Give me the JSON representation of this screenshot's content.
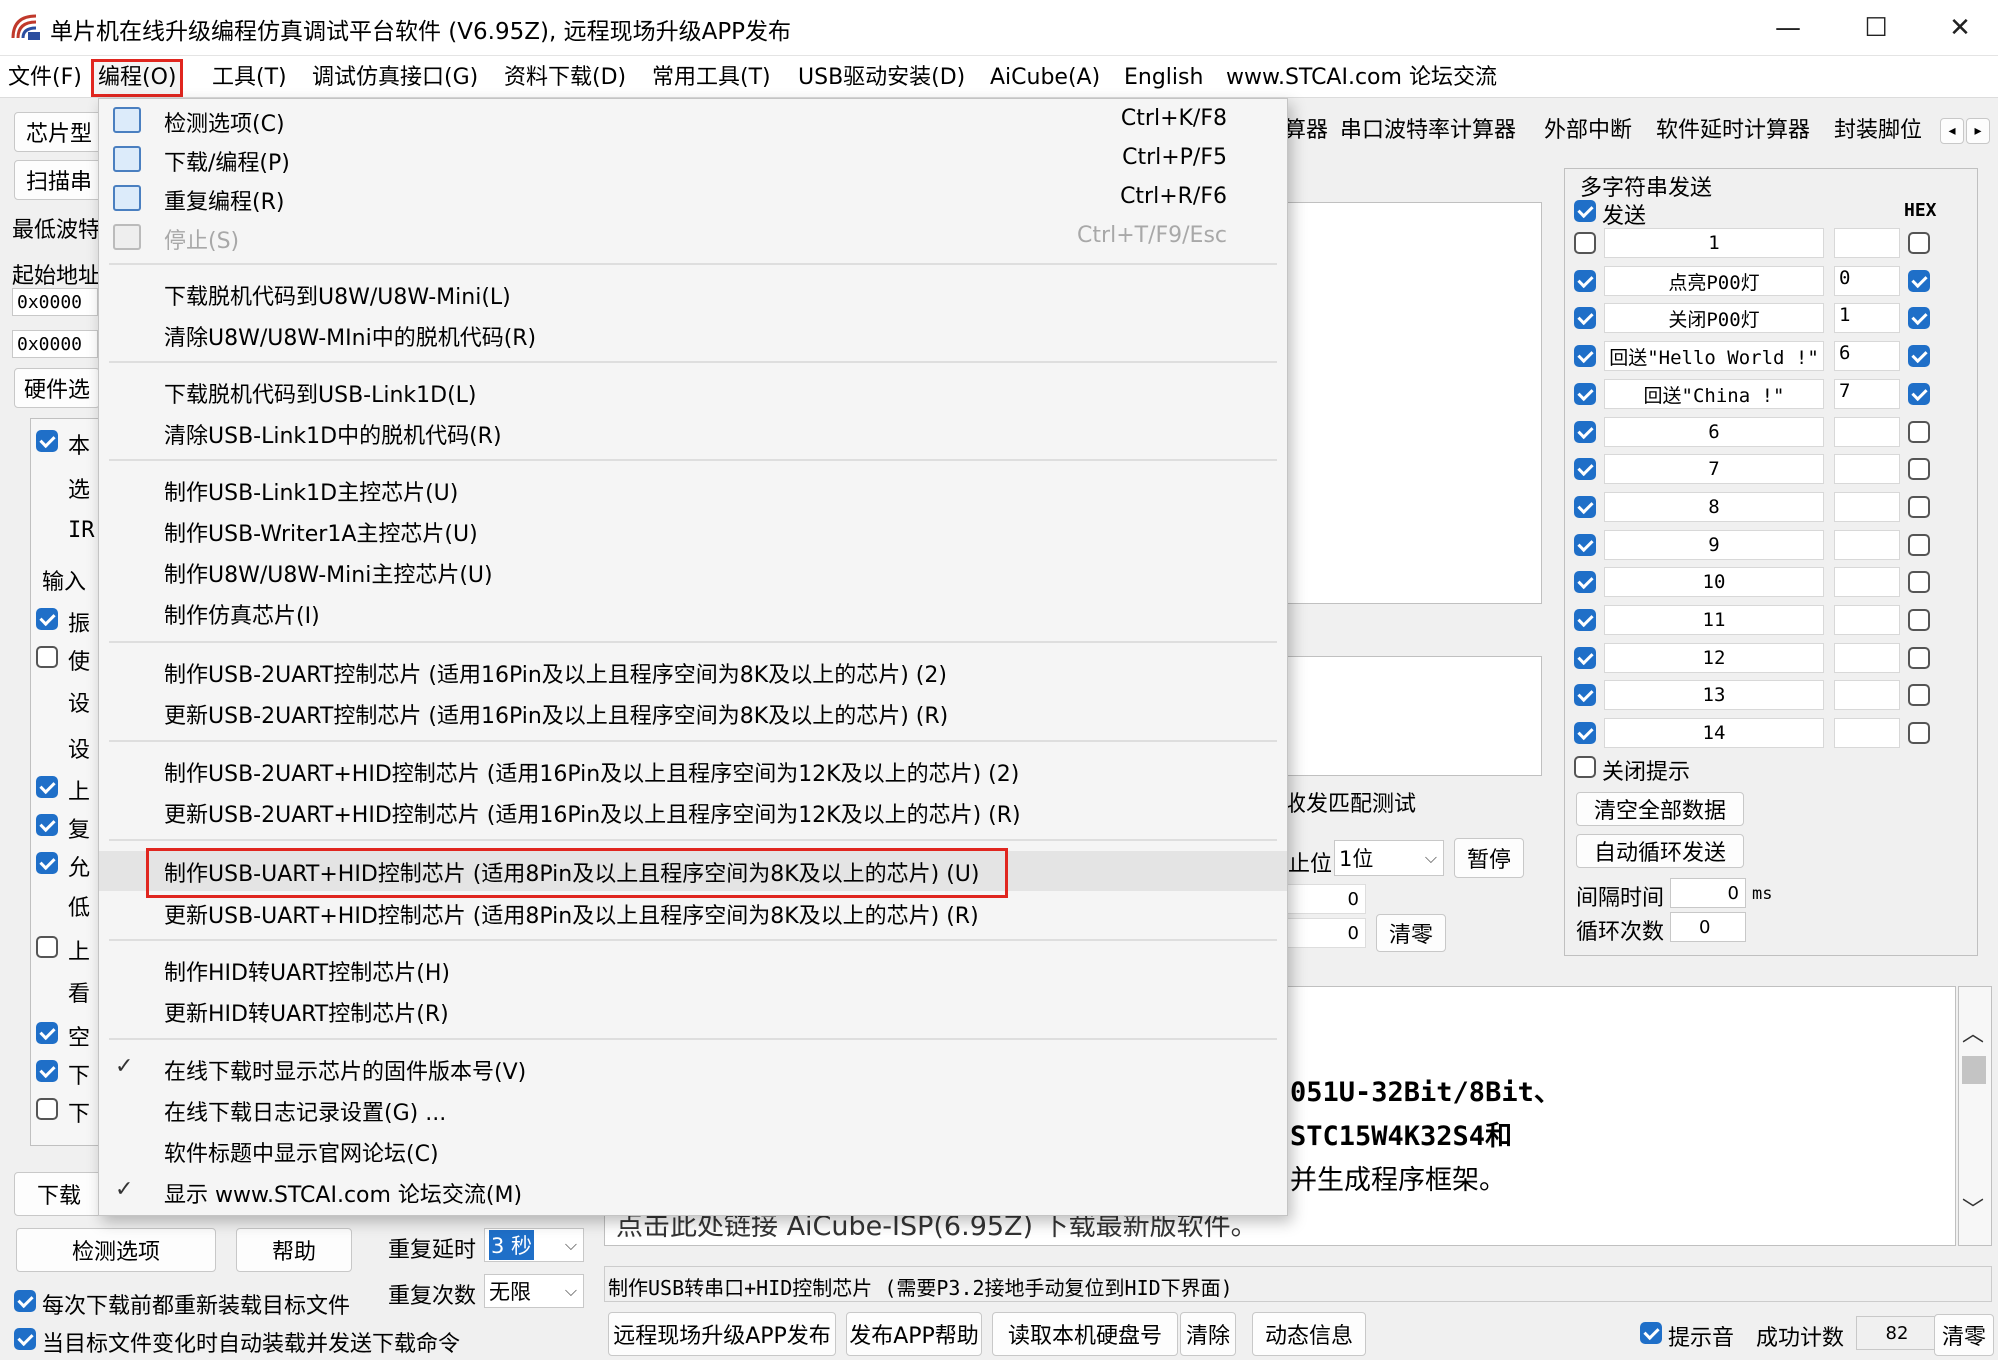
{
  "window": {
    "title": "单片机在线升级编程仿真调试平台软件 (V6.95Z), 远程现场升级APP发布",
    "minimize": "—",
    "maximize": "☐",
    "close": "✕"
  },
  "menubar": [
    "文件(F)",
    "编程(O)",
    "工具(T)",
    "调试仿真接口(G)",
    "资料下载(D)",
    "常用工具(T)",
    "USB驱动安装(D)",
    "AiCube(A)",
    "English",
    "www.STCAI.com 论坛交流"
  ],
  "dropdown": {
    "items": [
      {
        "label": "检测选项(C)",
        "shortcut": "Ctrl+K/F8"
      },
      {
        "label": "下载/编程(P)",
        "shortcut": "Ctrl+P/F5"
      },
      {
        "label": "重复编程(R)",
        "shortcut": "Ctrl+R/F6"
      },
      {
        "label": "停止(S)",
        "shortcut": "Ctrl+T/F9/Esc"
      },
      {
        "label": "下载脱机代码到U8W/U8W-Mini(L)",
        "shortcut": ""
      },
      {
        "label": "清除U8W/U8W-MIni中的脱机代码(R)",
        "shortcut": ""
      },
      {
        "label": "下载脱机代码到USB-Link1D(L)",
        "shortcut": ""
      },
      {
        "label": "清除USB-Link1D中的脱机代码(R)",
        "shortcut": ""
      },
      {
        "label": "制作USB-Link1D主控芯片(U)",
        "shortcut": ""
      },
      {
        "label": "制作USB-Writer1A主控芯片(U)",
        "shortcut": ""
      },
      {
        "label": "制作U8W/U8W-Mini主控芯片(U)",
        "shortcut": ""
      },
      {
        "label": "制作仿真芯片(I)",
        "shortcut": ""
      },
      {
        "label": "制作USB-2UART控制芯片 (适用16Pin及以上且程序空间为8K及以上的芯片) (2)",
        "shortcut": ""
      },
      {
        "label": "更新USB-2UART控制芯片 (适用16Pin及以上且程序空间为8K及以上的芯片) (R)",
        "shortcut": ""
      },
      {
        "label": "制作USB-2UART+HID控制芯片 (适用16Pin及以上且程序空间为12K及以上的芯片) (2)",
        "shortcut": ""
      },
      {
        "label": "更新USB-2UART+HID控制芯片 (适用16Pin及以上且程序空间为12K及以上的芯片) (R)",
        "shortcut": ""
      },
      {
        "label": "制作USB-UART+HID控制芯片 (适用8Pin及以上且程序空间为8K及以上的芯片) (U)",
        "shortcut": ""
      },
      {
        "label": "更新USB-UART+HID控制芯片 (适用8Pin及以上且程序空间为8K及以上的芯片) (R)",
        "shortcut": ""
      },
      {
        "label": "制作HID转UART控制芯片(H)",
        "shortcut": ""
      },
      {
        "label": "更新HID转UART控制芯片(R)",
        "shortcut": ""
      },
      {
        "label": "在线下载时显示芯片的固件版本号(V)",
        "shortcut": ""
      },
      {
        "label": "在线下载日志记录设置(G) ...",
        "shortcut": ""
      },
      {
        "label": "软件标题中显示官网论坛(C)",
        "shortcut": ""
      },
      {
        "label": "显示 www.STCAI.com 论坛交流(M)",
        "shortcut": ""
      }
    ]
  },
  "left": {
    "chip_type": "芯片型",
    "scan": "扫描串",
    "min_baud": "最低波特",
    "start_addr": "起始地址",
    "addr1": "0x0000",
    "addr2": "0x0000",
    "hw_tab": "硬件选",
    "opt_labels": [
      "本",
      "选",
      "IR",
      "输入",
      "振",
      "使",
      "设",
      "设",
      "上",
      "复",
      "允",
      "低",
      "上",
      "看",
      "空",
      "下",
      "下"
    ],
    "download_btn": "下载",
    "detect_btn": "检测选项",
    "help_btn": "帮助",
    "repeat_delay_label": "重复延时",
    "repeat_delay_value": "3 秒",
    "repeat_count_label": "重复次数",
    "repeat_count_value": "无限",
    "reload_each": "每次下载前都重新装载目标文件",
    "auto_reload": "当目标文件变化时自动装载并发送下载命令"
  },
  "tabs": [
    "算器",
    "串口波特率计算器",
    "外部中断",
    "软件延时计算器",
    "封装脚位"
  ],
  "multi_send": {
    "title": "多字符串发送",
    "send_label": "发送",
    "hex_label": "HEX",
    "rows": [
      {
        "text": "1",
        "num": ""
      },
      {
        "text": "点亮P00灯",
        "num": "0"
      },
      {
        "text": "关闭P00灯",
        "num": "1"
      },
      {
        "text": "回送\"Hello World !\"",
        "num": "6"
      },
      {
        "text": "回送\"China !\"",
        "num": "7"
      },
      {
        "text": "6",
        "num": ""
      },
      {
        "text": "7",
        "num": ""
      },
      {
        "text": "8",
        "num": ""
      },
      {
        "text": "9",
        "num": ""
      },
      {
        "text": "10",
        "num": ""
      },
      {
        "text": "11",
        "num": ""
      },
      {
        "text": "12",
        "num": ""
      },
      {
        "text": "13",
        "num": ""
      },
      {
        "text": "14",
        "num": ""
      }
    ],
    "close_hint": "关闭提示",
    "clear_all": "清空全部数据",
    "auto_loop": "自动循环发送",
    "interval_label": "间隔时间",
    "interval_value": "0",
    "interval_unit": "ms",
    "loop_label": "循环次数",
    "loop_value": "0"
  },
  "middle": {
    "match_test": "收发匹配测试",
    "stop_bit_label": "止位",
    "stop_bit_value": "1位",
    "pause_btn": "暂停",
    "count1": "0",
    "count2": "0",
    "clear_btn": "清零"
  },
  "log": {
    "line1": "051U-32Bit/8Bit、",
    "line2": "STC15W4K32S4和",
    "line3": "并生成程序框架。",
    "line4": "点击此处链接 AiCube-ISP(6.95Z) 下载最新版软件。",
    "status": "制作USB转串口+HID控制芯片 (需要P3.2接地手动复位到HID下界面)"
  },
  "bottom": {
    "remote_upgrade": "远程现场升级APP发布",
    "publish_help": "发布APP帮助",
    "read_disk": "读取本机硬盘号",
    "clear": "清除",
    "dyn_info": "动态信息",
    "beep": "提示音",
    "success_count_label": "成功计数",
    "success_count": "82",
    "zero_btn": "清零"
  }
}
